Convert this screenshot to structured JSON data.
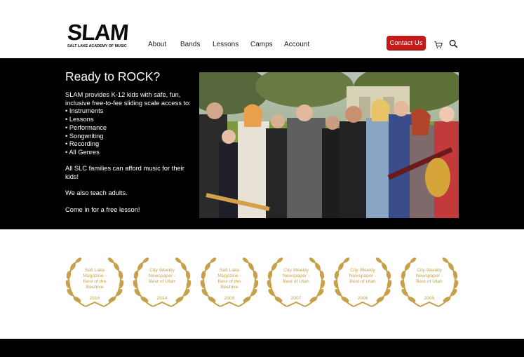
{
  "logo": {
    "mark": "SLAM",
    "subtitle": "SALT LAKE ACADEMY OF MUSIC"
  },
  "nav": {
    "items": [
      "About",
      "Bands",
      "Lessons",
      "Camps",
      "Account"
    ]
  },
  "header": {
    "contact_label": "Contact Us"
  },
  "icons": {
    "cart": "cart-icon",
    "search": "search-icon"
  },
  "hero": {
    "title": "Ready to ROCK?",
    "intro": "SLAM provides K-12 kids with safe, fun, inclusive free-to-fee sliding scale access to:",
    "bullets": [
      "• Instruments",
      "• Lessons",
      "• Performance",
      "• Songwriting",
      "• Recording",
      "• All Genres"
    ],
    "line_families": "All SLC families can afford music for their kids!",
    "line_adults": "We also teach adults.",
    "line_cta": "Come in for a free lesson!"
  },
  "awards": [
    {
      "text": "Salt Lake Magazine - Best of the Beehive",
      "year": "2016"
    },
    {
      "text": "City Weekly Newspaper - Best of Utah",
      "year": "2014"
    },
    {
      "text": "Salt Lake Magazine - Best of the Beehive",
      "year": "2009"
    },
    {
      "text": "City Weekly Newspaper - Best of Utah",
      "year": "2007"
    },
    {
      "text": "City Weekly Newspaper - Best of Utah",
      "year": "2006"
    },
    {
      "text": "City Weekly Newspaper - Best of Utah",
      "year": "2005"
    }
  ],
  "colors": {
    "accent": "#c51a1a",
    "gold": "#c9a04a",
    "hero_bg": "#000000"
  }
}
